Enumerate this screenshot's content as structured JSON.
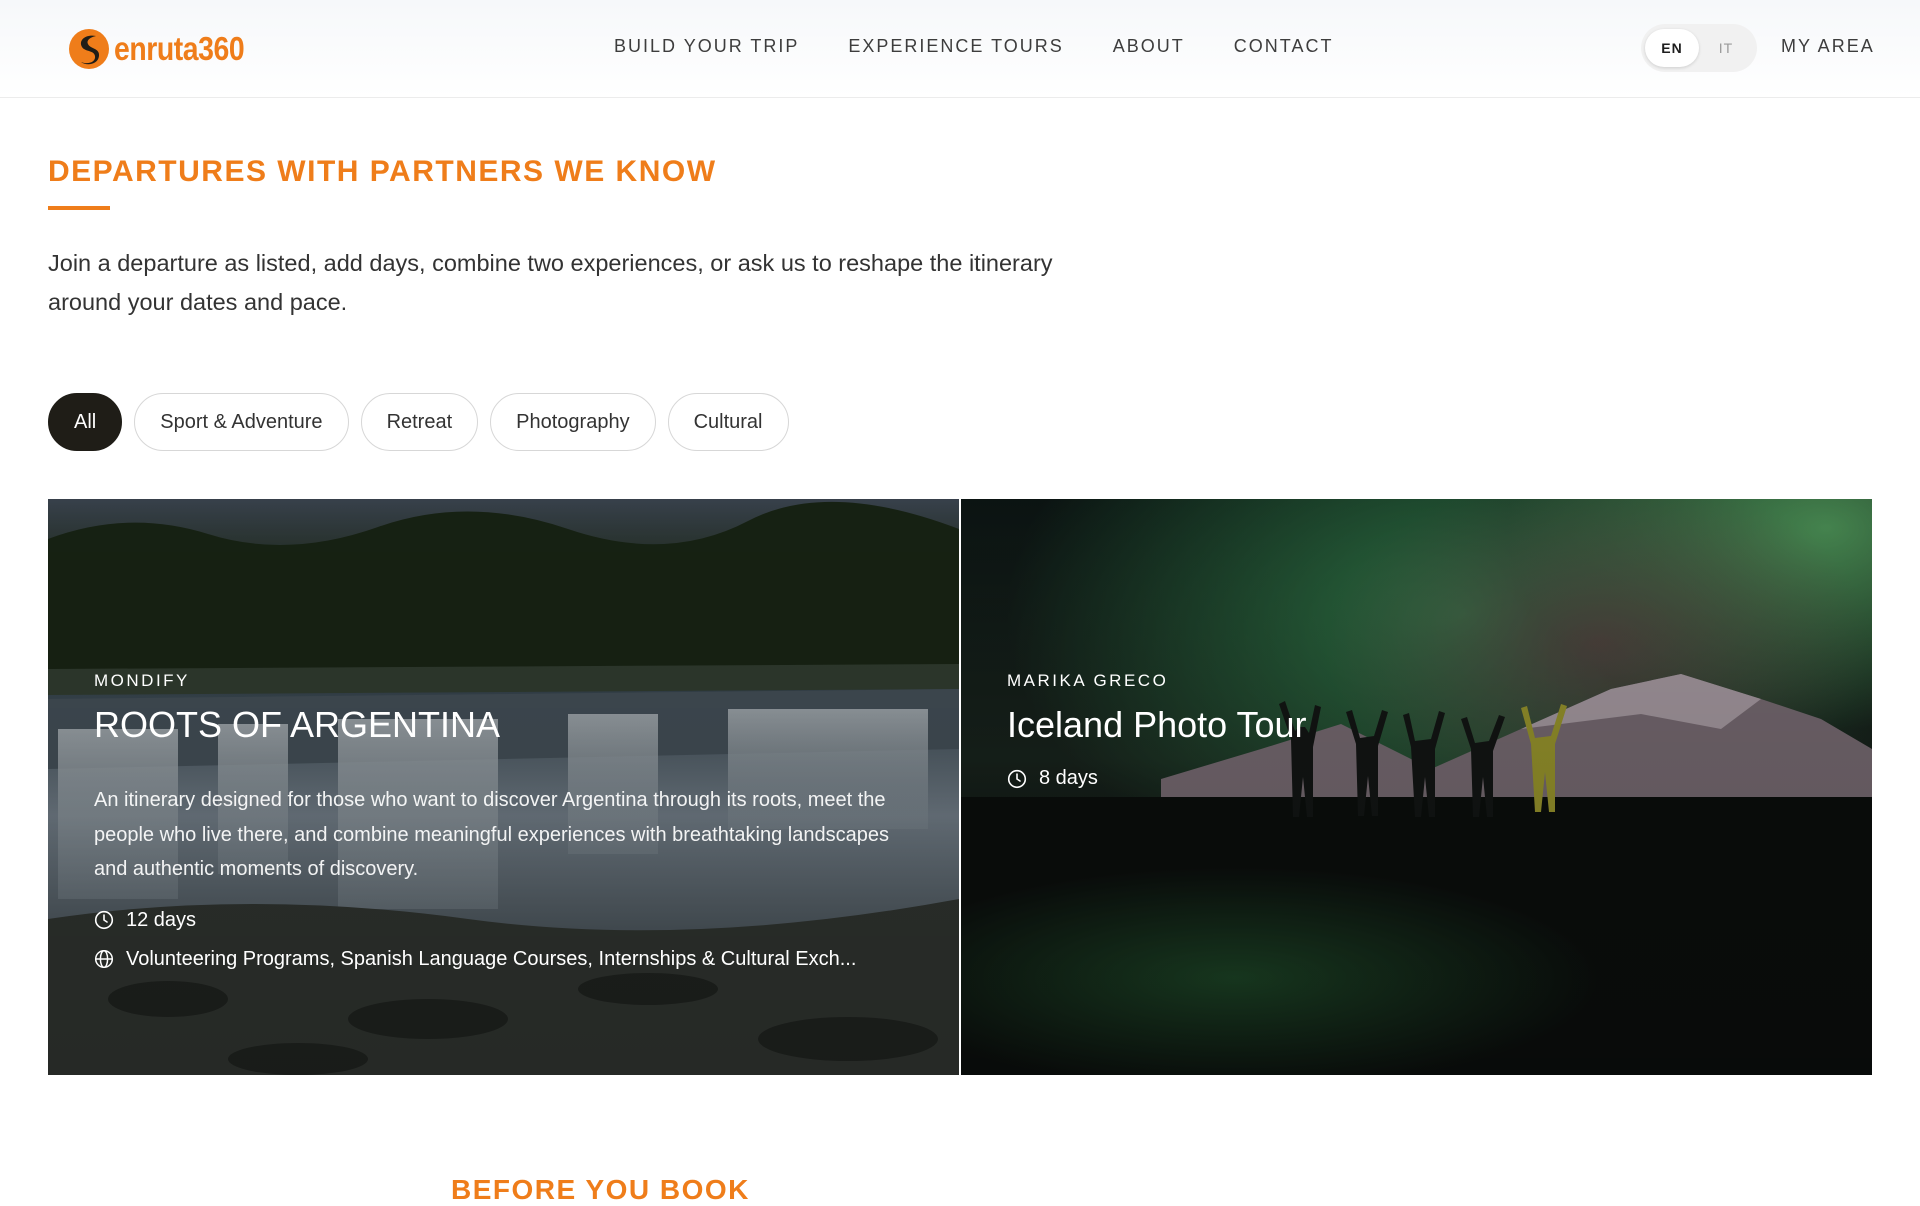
{
  "header": {
    "logo_text": "enruta360",
    "nav": [
      {
        "label": "BUILD YOUR TRIP"
      },
      {
        "label": "EXPERIENCE TOURS"
      },
      {
        "label": "ABOUT"
      },
      {
        "label": "CONTACT"
      }
    ],
    "languages": [
      {
        "label": "EN",
        "active": true
      },
      {
        "label": "IT",
        "active": false
      }
    ],
    "my_area": "MY AREA"
  },
  "section": {
    "title": "DEPARTURES WITH PARTNERS WE KNOW",
    "intro": "Join a departure as listed, add days, combine two experiences, or ask us to reshape the itinerary around your dates and pace.",
    "filters": [
      {
        "label": "All",
        "active": true
      },
      {
        "label": "Sport & Adventure",
        "active": false
      },
      {
        "label": "Retreat",
        "active": false
      },
      {
        "label": "Photography",
        "active": false
      },
      {
        "label": "Cultural",
        "active": false
      }
    ],
    "cards": [
      {
        "partner": "MONDIFY",
        "title": "ROOTS OF ARGENTINA",
        "description": "An itinerary designed for those who want to discover Argentina through its roots, meet the people who live there, and combine meaningful experiences with breathtaking landscapes and authentic moments of discovery.",
        "duration": "12 days",
        "categories": "Volunteering Programs, Spanish Language Courses, Internships & Cultural Exch..."
      },
      {
        "partner": "MARIKA GRECO",
        "title": "Iceland Photo Tour",
        "duration": "8 days"
      }
    ]
  },
  "next_section": {
    "title": "BEFORE YOU BOOK"
  },
  "colors": {
    "brand_orange": "#ef7d1a",
    "chip_active": "#1f1d17"
  }
}
